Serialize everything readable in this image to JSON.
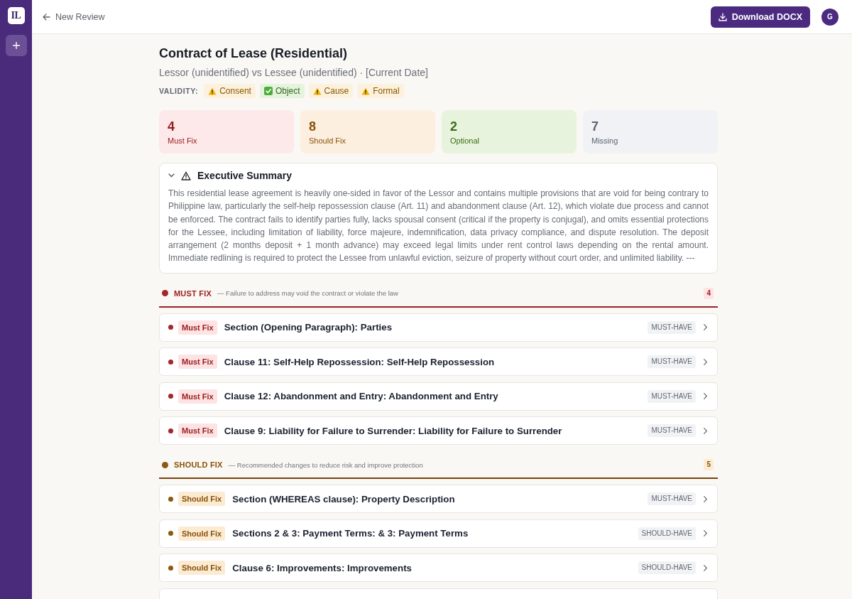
{
  "sidebar": {
    "logo": "IL"
  },
  "topbar": {
    "back_link": "New Review",
    "download_button": "Download DOCX",
    "avatar": "G"
  },
  "document": {
    "title": "Contract of Lease (Residential)",
    "subtitle": "Lessor (unidentified) vs Lessee (unidentified) · [Current Date]",
    "validity_label": "VALIDITY:",
    "validity": [
      {
        "label": "Consent",
        "kind": "warning"
      },
      {
        "label": "Object",
        "kind": "ok"
      },
      {
        "label": "Cause",
        "kind": "warning"
      },
      {
        "label": "Formal",
        "kind": "warning"
      }
    ]
  },
  "stats": [
    {
      "value": "4",
      "label": "Must Fix",
      "kind": "must"
    },
    {
      "value": "8",
      "label": "Should Fix",
      "kind": "should"
    },
    {
      "value": "2",
      "label": "Optional",
      "kind": "optional"
    },
    {
      "value": "7",
      "label": "Missing",
      "kind": "missing"
    }
  ],
  "summary": {
    "title": "Executive Summary",
    "expanded": true,
    "text": "This residential lease agreement is heavily one-sided in favor of the Lessor and contains multiple provisions that are void for being contrary to Philippine law, particularly the self-help repossession clause (Art. 11) and abandonment clause (Art. 12), which violate due process and cannot be enforced. The contract fails to identify parties fully, lacks spousal consent (critical if the property is conjugal), and omits essential protections for the Lessee, including limitation of liability, force majeure, indemnification, data privacy compliance, and dispute resolution. The deposit arrangement (2 months deposit + 1 month advance) may exceed legal limits under rent control laws depending on the rental amount. Immediate redlining is required to protect the Lessee from unlawful eviction, seizure of property without court order, and unlimited liability. ---"
  },
  "sections": [
    {
      "kind": "must",
      "title": "MUST FIX",
      "description": "— Failure to address may void the contract or violate the law",
      "count": "4",
      "more_below": false,
      "items": [
        {
          "badge": "Must Fix",
          "title": "Section (Opening Paragraph): Parties",
          "tag": "MUST-HAVE"
        },
        {
          "badge": "Must Fix",
          "title": "Clause 11: Self-Help Repossession: Self-Help Repossession",
          "tag": "MUST-HAVE"
        },
        {
          "badge": "Must Fix",
          "title": "Clause 12: Abandonment and Entry: Abandonment and Entry",
          "tag": "MUST-HAVE"
        },
        {
          "badge": "Must Fix",
          "title": "Clause 9: Liability for Failure to Surrender: Liability for Failure to Surrender",
          "tag": "MUST-HAVE"
        }
      ]
    },
    {
      "kind": "should",
      "title": "SHOULD FIX",
      "description": "— Recommended changes to reduce risk and improve protection",
      "count": "5",
      "more_below": true,
      "items": [
        {
          "badge": "Should Fix",
          "title": "Section (WHEREAS clause): Property Description",
          "tag": "MUST-HAVE"
        },
        {
          "badge": "Should Fix",
          "title": "Sections 2 & 3: Payment Terms: & 3: Payment Terms",
          "tag": "SHOULD-HAVE"
        },
        {
          "badge": "Should Fix",
          "title": "Clause 6: Improvements: Improvements",
          "tag": "SHOULD-HAVE"
        }
      ]
    }
  ]
}
